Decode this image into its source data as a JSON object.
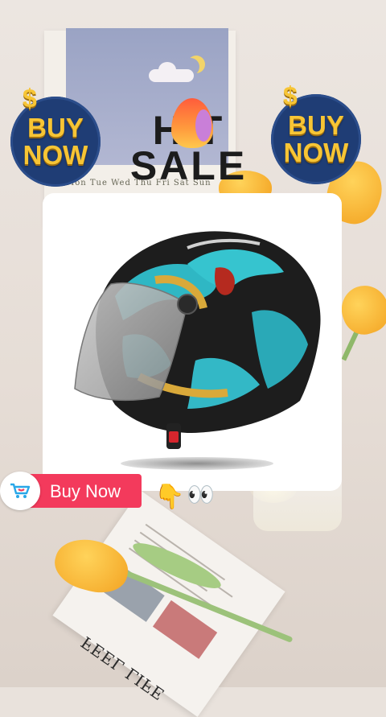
{
  "banner": {
    "badge_left_text": [
      "BUY",
      "NOW"
    ],
    "badge_right_text": [
      "BUY",
      "NOW"
    ],
    "dollar_symbol": "$",
    "hot_word": "H T",
    "sale_word": "SALE"
  },
  "background": {
    "calendar_days": "Mon  Tue  Wed  Thu  Fri  Sat  Sun",
    "newspaper_headline": "FEEL LIFE"
  },
  "product": {
    "name": "helmet-image",
    "description": "open-face motorcycle helmet with dragon graphic and smoked visor"
  },
  "cta": {
    "label": "Buy Now",
    "icon": "shopping-cart-icon"
  },
  "decorations": {
    "pointing_hand": "👇",
    "eyes": "👀"
  },
  "colors": {
    "badge_blue": "#1f3d75",
    "badge_gold": "#f7c535",
    "cta_red": "#f33a5c",
    "cart_blue": "#29a7e8"
  }
}
